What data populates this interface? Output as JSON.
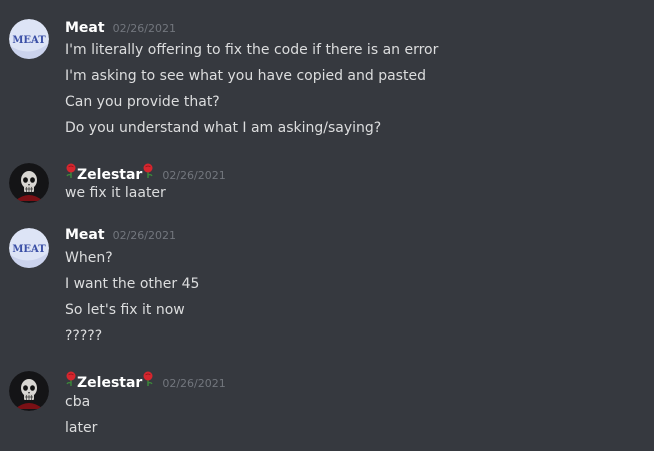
{
  "groups": [
    {
      "author": "Meat",
      "avatar_text": "MEAT",
      "timestamp": "02/26/2021",
      "messages": [
        "I'm literally offering to fix the code if there is an error",
        "I'm asking to see what you have copied and pasted",
        "Can you provide that?",
        "Do you understand what I am asking/saying?"
      ]
    },
    {
      "author": "Zelestar",
      "timestamp": "02/26/2021",
      "messages": [
        "we fix it laater"
      ]
    },
    {
      "author": "Meat",
      "avatar_text": "MEAT",
      "timestamp": "02/26/2021",
      "messages": [
        "When?",
        "I want the other 45",
        "So let's fix it now",
        "?????"
      ]
    },
    {
      "author": "Zelestar",
      "timestamp": "02/26/2021",
      "messages": [
        "cba",
        "later"
      ]
    }
  ],
  "colors": {
    "background": "#36393f",
    "username": "#ffffff",
    "message_text": "#dcddde",
    "timestamp": "#72767d",
    "meat_avatar": "#dde4f6",
    "rose": "#d6262e"
  },
  "icons": {
    "meat_avatar": "meat-avatar",
    "zelestar_avatar": "skull-avatar",
    "rose": "rose-icon"
  }
}
